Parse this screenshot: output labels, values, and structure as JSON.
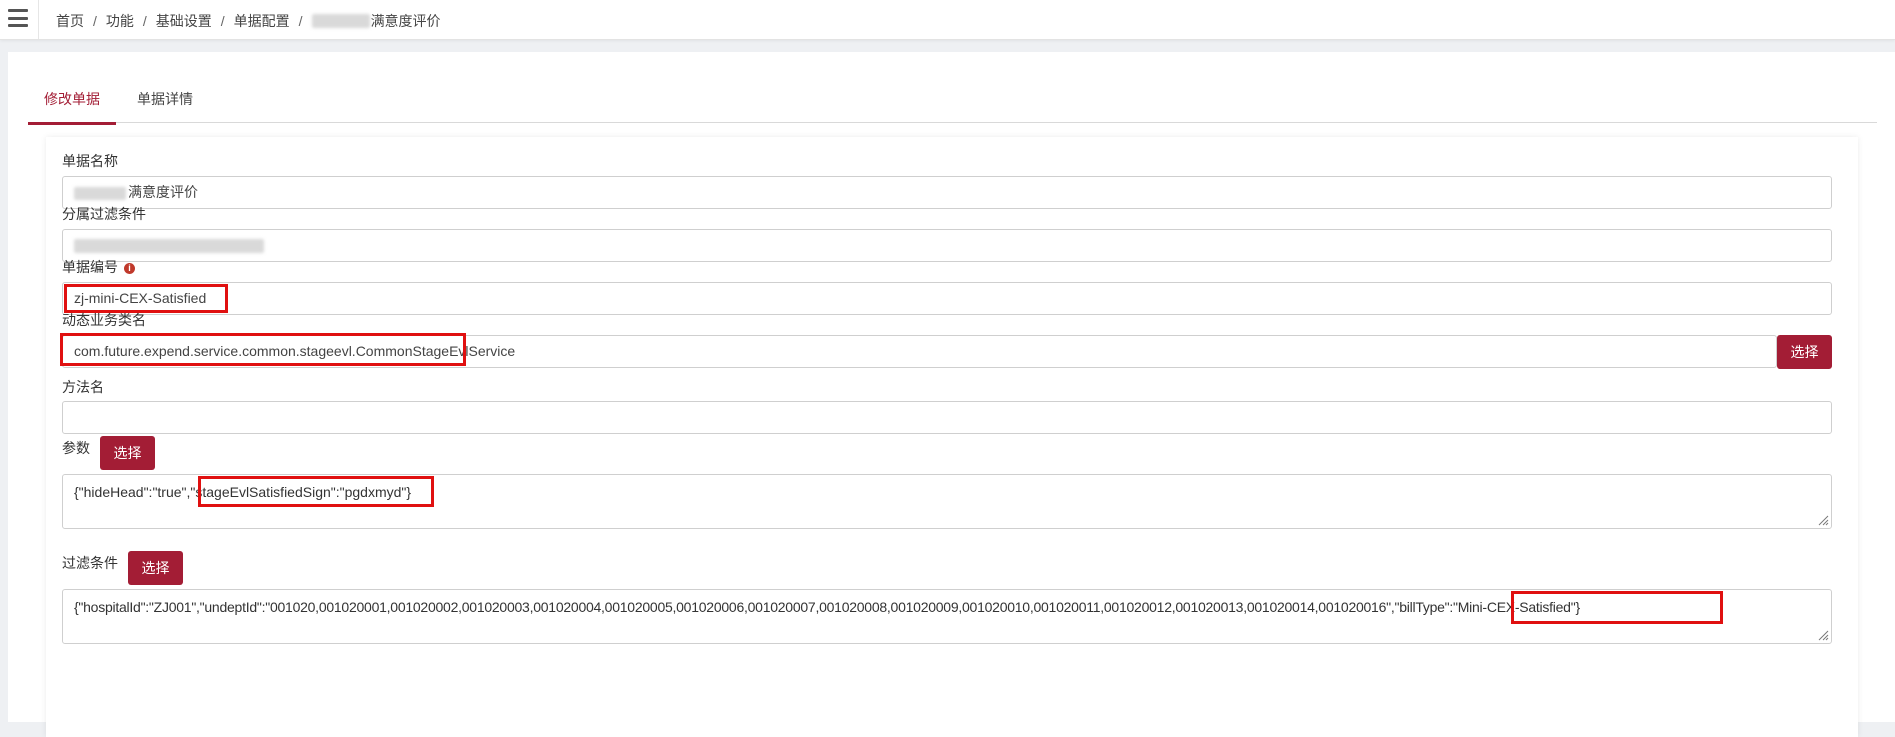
{
  "breadcrumb": {
    "items": [
      "首页",
      "功能",
      "基础设置",
      "单据配置",
      "满意度评价"
    ],
    "separator": "/"
  },
  "tabs": [
    {
      "label": "修改单据",
      "active": true
    },
    {
      "label": "单据详情",
      "active": false
    }
  ],
  "form": {
    "bill_name": {
      "label": "单据名称",
      "value": "满意度评价"
    },
    "filter_subcondition": {
      "label": "分属过滤条件",
      "value": ""
    },
    "bill_code": {
      "label": "单据编号",
      "value": "zj-mini-CEX-Satisfied",
      "info_icon": "info-icon"
    },
    "service_class": {
      "label": "动态业务类名",
      "value": "com.future.expend.service.common.stageevl.CommonStageEvlService",
      "button": "选择"
    },
    "method_name": {
      "label": "方法名",
      "value": ""
    },
    "params": {
      "label": "参数",
      "button": "选择",
      "value": "{\"hideHead\":\"true\",\"stageEvlSatisfiedSign\":\"pgdxmyd\"}"
    },
    "filter_condition": {
      "label": "过滤条件",
      "button": "选择",
      "value": "{\"hospitalId\":\"ZJ001\",\"undeptId\":\"001020,001020001,001020002,001020003,001020004,001020005,001020006,001020007,001020008,001020009,001020010,001020011,001020012,001020013,001020014,001020016\",\"billType\":\"Mini-CEX-Satisfied\"}"
    }
  },
  "colors": {
    "accent": "#a31d35",
    "highlight": "#e01010"
  }
}
